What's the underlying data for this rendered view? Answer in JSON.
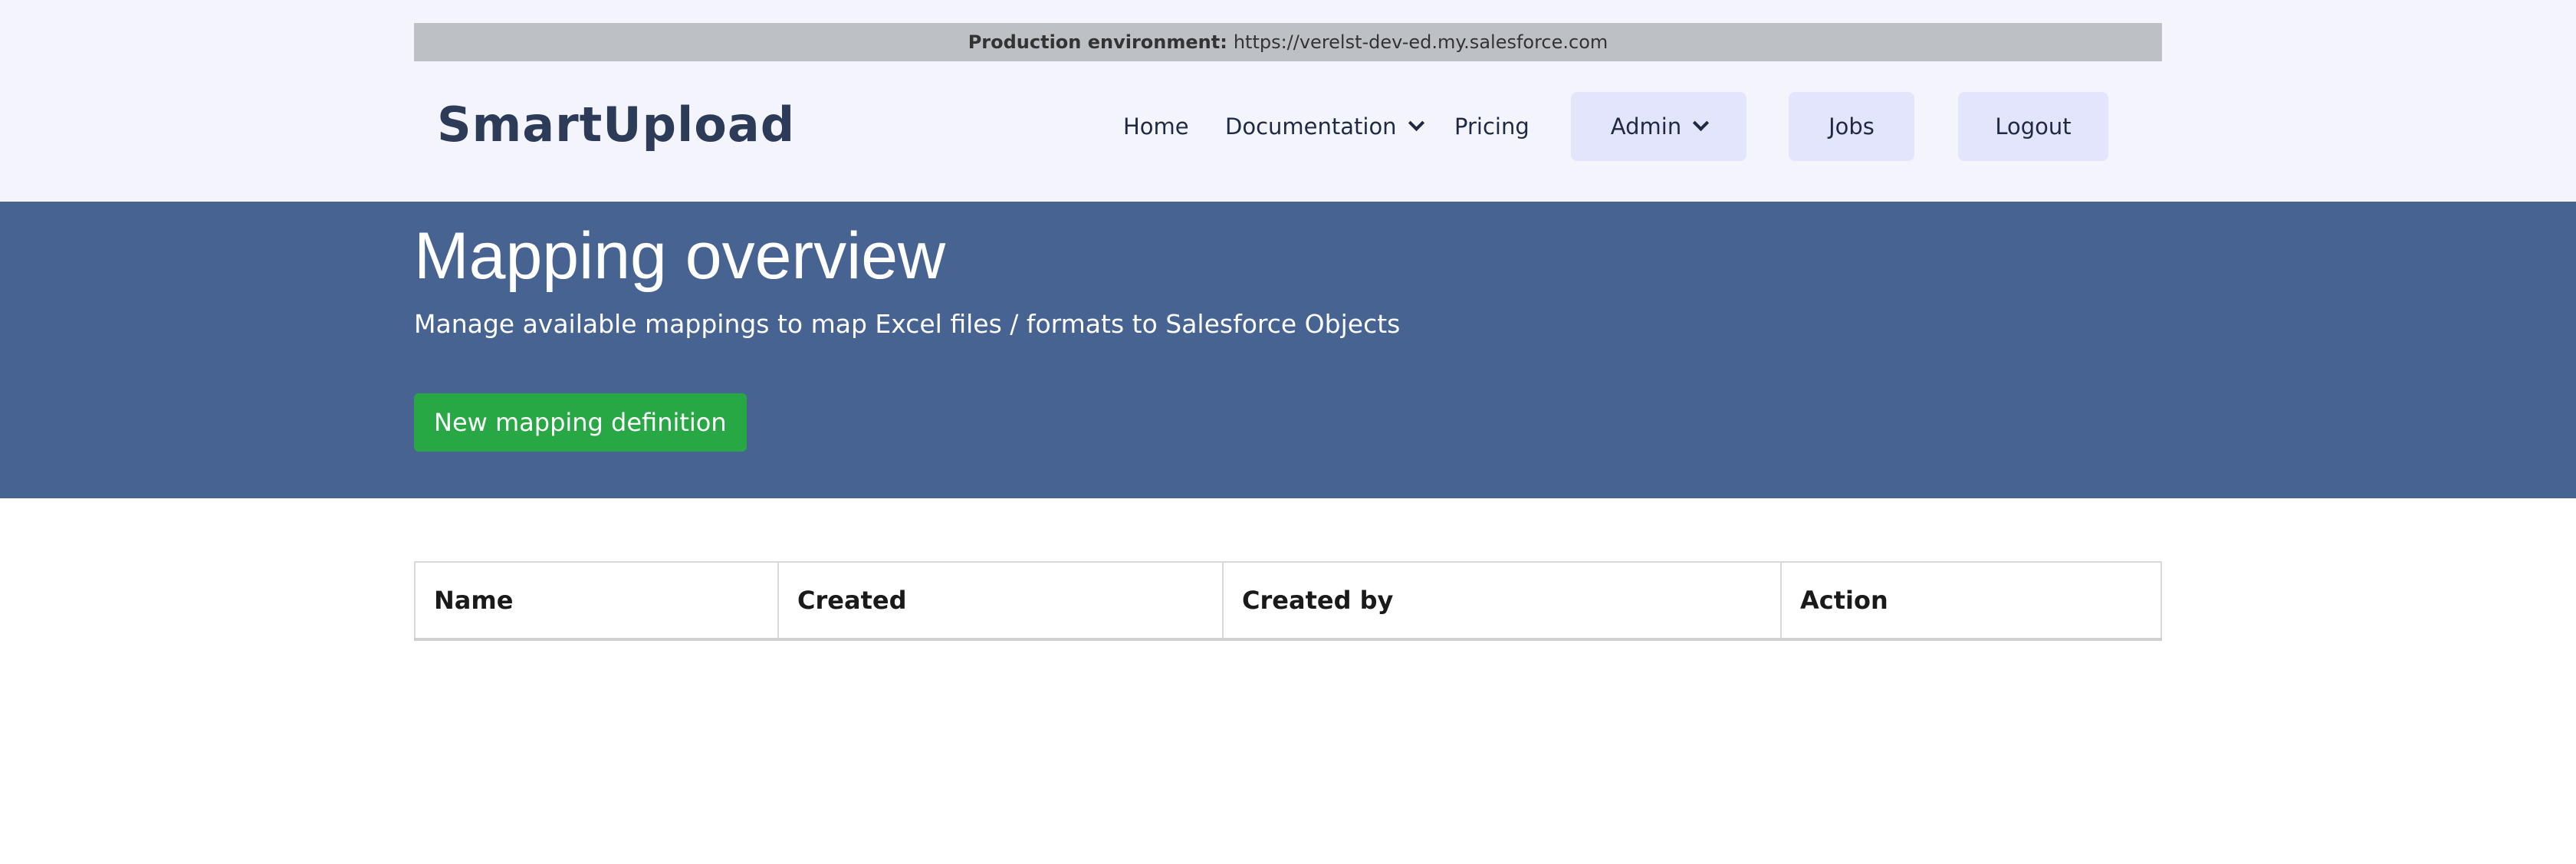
{
  "env_bar": {
    "label": "Production environment:",
    "url": "https://verelst-dev-ed.my.salesforce.com"
  },
  "header": {
    "logo": "SmartUpload",
    "nav": {
      "home": "Home",
      "documentation": "Documentation",
      "pricing": "Pricing",
      "admin": "Admin",
      "jobs": "Jobs",
      "logout": "Logout"
    }
  },
  "hero": {
    "title": "Mapping overview",
    "subtitle": "Manage available mappings to map Excel files / formats to Salesforce Objects",
    "new_button": "New mapping definition"
  },
  "table": {
    "columns": [
      "Name",
      "Created",
      "Created by",
      "Action"
    ]
  },
  "colors": {
    "top_background": "#f4f5fc",
    "env_bar": "#bdc1c6",
    "hero_background": "#466391",
    "primary_button": "#28a745",
    "nav_pill": "#e2e5fc"
  },
  "icons": {
    "documentation_dropdown": "chevron-down-icon",
    "admin_dropdown": "chevron-down-icon"
  }
}
